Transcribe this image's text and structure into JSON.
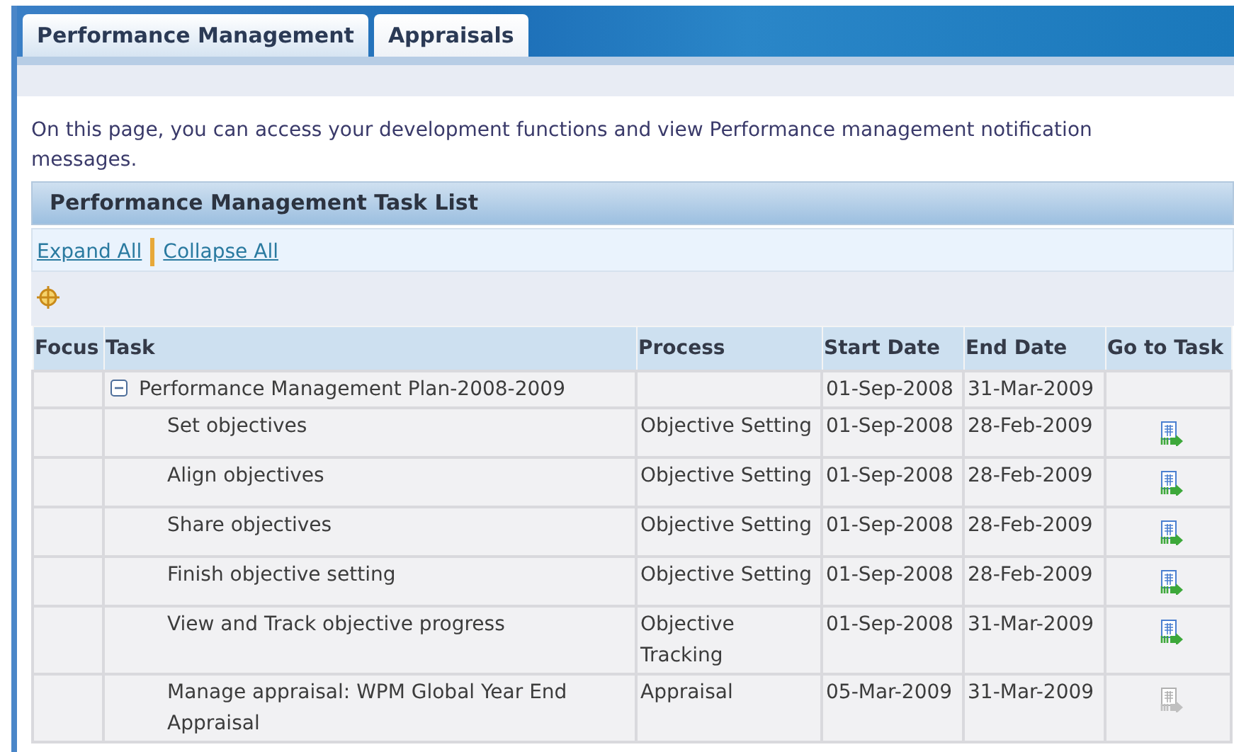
{
  "tabs": [
    {
      "label": "Performance Management",
      "selected": true
    },
    {
      "label": "Appraisals",
      "selected": false
    }
  ],
  "intro": "On this page, you can access your development functions and view Performance management notification messages.",
  "section": {
    "title": "Performance Management Task List",
    "links": [
      "Expand All",
      "Collapse All"
    ]
  },
  "table": {
    "columns": [
      "Focus",
      "Task",
      "Process",
      "Start Date",
      "End Date",
      "Go to Task"
    ],
    "rows": [
      {
        "task": "Performance Management Plan-2008-2009",
        "process": "",
        "start": "01-Sep-2008",
        "end": "31-Mar-2009",
        "expanded": true,
        "children": [
          {
            "task": "Set objectives",
            "process": "Objective Setting",
            "start": "01-Sep-2008",
            "end": "28-Feb-2009",
            "enabled": true
          },
          {
            "task": "Align objectives",
            "process": "Objective Setting",
            "start": "01-Sep-2008",
            "end": "28-Feb-2009",
            "enabled": true
          },
          {
            "task": "Share objectives",
            "process": "Objective Setting",
            "start": "01-Sep-2008",
            "end": "28-Feb-2009",
            "enabled": true
          },
          {
            "task": "Finish objective setting",
            "process": "Objective Setting",
            "start": "01-Sep-2008",
            "end": "28-Feb-2009",
            "enabled": true
          },
          {
            "task": "View and Track objective progress",
            "process": "Objective Tracking",
            "start": "01-Sep-2008",
            "end": "31-Mar-2009",
            "enabled": true
          },
          {
            "task": "Manage appraisal: WPM Global Year End Appraisal",
            "process": "Appraisal",
            "start": "05-Mar-2009",
            "end": "31-Mar-2009",
            "enabled": false
          }
        ]
      }
    ]
  }
}
